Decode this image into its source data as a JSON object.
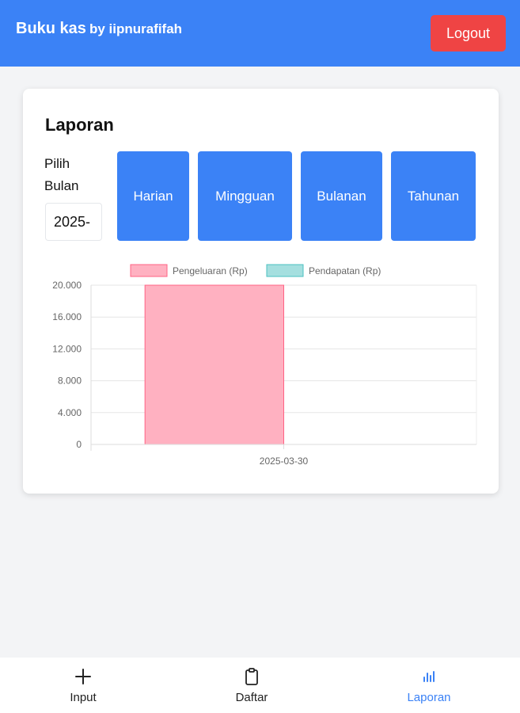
{
  "header": {
    "title": "Buku kas",
    "byline": "by iipnurafifah",
    "logout_label": "Logout"
  },
  "report": {
    "title": "Laporan",
    "pick_month_label": "Pilih Bulan",
    "month_value": "2025-",
    "periods": [
      "Harian",
      "Mingguan",
      "Bulanan",
      "Tahunan"
    ]
  },
  "chart_data": {
    "type": "bar",
    "categories": [
      "2025-03-30"
    ],
    "series": [
      {
        "name": "Pengeluaran (Rp)",
        "values": [
          20000
        ],
        "color": "#ffb1c1",
        "border": "#ff6384"
      },
      {
        "name": "Pendapatan (Rp)",
        "values": [
          0
        ],
        "color": "#a5dfdf",
        "border": "#4bc0c0"
      }
    ],
    "y_ticks": [
      "0",
      "4.000",
      "8.000",
      "12.000",
      "16.000",
      "20.000"
    ],
    "ylim": [
      0,
      20000
    ],
    "grid": true,
    "legend": "top"
  },
  "bottom_nav": {
    "items": [
      {
        "label": "Input",
        "icon": "plus-icon"
      },
      {
        "label": "Daftar",
        "icon": "clipboard-icon"
      },
      {
        "label": "Laporan",
        "icon": "bar-chart-icon",
        "active": true
      }
    ],
    "active_color": "#3b82f6"
  },
  "colors": {
    "primary": "#3b82f6",
    "danger": "#ef4444",
    "background": "#f3f4f6"
  }
}
